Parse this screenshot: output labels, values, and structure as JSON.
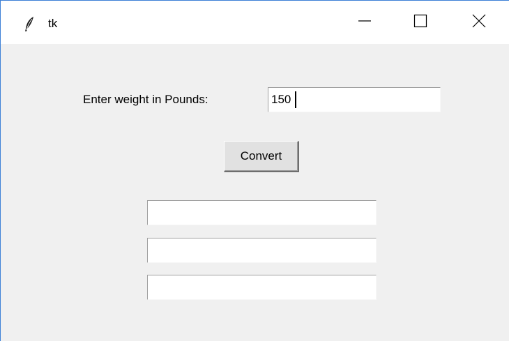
{
  "window": {
    "title": "tk",
    "icon": "feather-icon",
    "controls": {
      "minimize_icon": "minimize-icon",
      "maximize_icon": "maximize-icon",
      "close_icon": "close-icon"
    }
  },
  "form": {
    "weight_label": "Enter weight in Pounds:",
    "weight_value": "150",
    "convert_label": "Convert",
    "outputs": [
      "",
      "",
      ""
    ]
  },
  "colors": {
    "window_border": "#3c7fd6",
    "client_background": "#f0f0f0",
    "titlebar_background": "#ffffff"
  }
}
